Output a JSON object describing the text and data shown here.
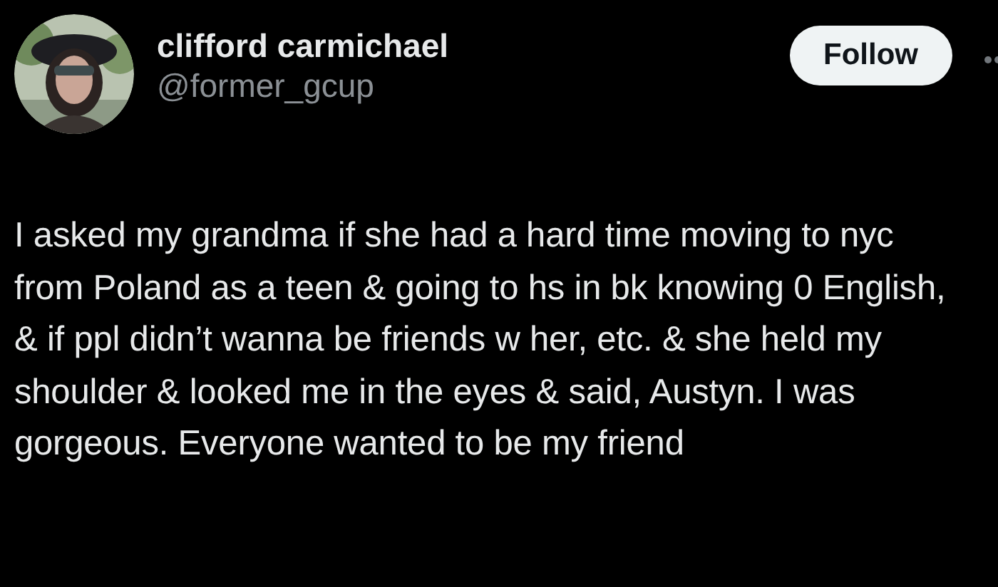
{
  "author": {
    "name": "clifford carmichael",
    "handle": "@former_gcup"
  },
  "follow_button": {
    "label": "Follow"
  },
  "post": {
    "text": "I asked my grandma if she had a hard time moving to nyc from Poland as a teen & going to hs in bk knowing 0 English, & if ppl didn’t wanna be friends w her, etc. & she held my shoulder & looked me in the eyes & said, Austyn. I was gorgeous. Everyone wanted to be my friend"
  }
}
